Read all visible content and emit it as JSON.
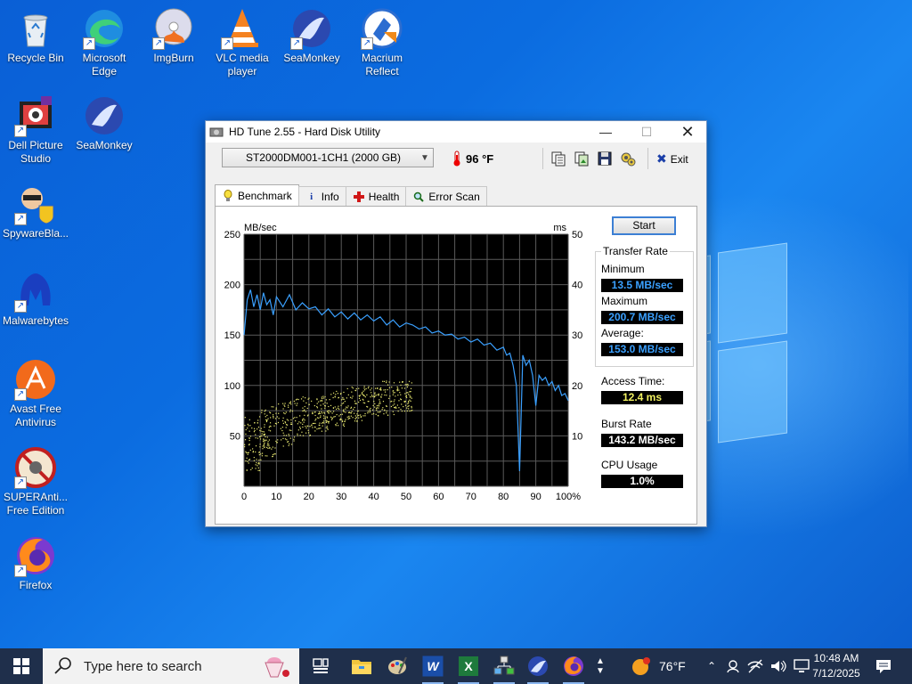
{
  "desktop": {
    "icons": [
      {
        "label": "Recycle Bin",
        "icon": "recycle-bin-icon"
      },
      {
        "label": "Microsoft Edge",
        "icon": "edge-icon"
      },
      {
        "label": "ImgBurn",
        "icon": "imgburn-icon"
      },
      {
        "label": "VLC media player",
        "icon": "vlc-icon"
      },
      {
        "label": "SeaMonkey",
        "icon": "seamonkey-icon"
      },
      {
        "label": "Macrium Reflect",
        "icon": "macrium-icon"
      },
      {
        "label": "Dell Picture Studio",
        "icon": "dell-picture-studio-icon"
      },
      {
        "label": "SeaMonkey",
        "icon": "seamonkey-icon"
      },
      {
        "label": "SpywareBla...",
        "icon": "spywareblaster-icon"
      },
      {
        "label": "Malwarebytes",
        "icon": "malwarebytes-icon"
      },
      {
        "label": "Avast Free Antivirus",
        "icon": "avast-icon"
      },
      {
        "label": "SUPERAnti... Free Edition",
        "icon": "superantispyware-icon"
      },
      {
        "label": "Firefox",
        "icon": "firefox-icon"
      }
    ]
  },
  "window": {
    "title": "HD Tune 2.55 - Hard Disk Utility",
    "drive": "ST2000DM001-1CH1 (2000 GB)",
    "temperature": "96 °F",
    "exit_label": "Exit",
    "tabs": [
      {
        "label": "Benchmark",
        "icon": "lightbulb-icon",
        "active": true
      },
      {
        "label": "Info",
        "icon": "info-icon",
        "active": false
      },
      {
        "label": "Health",
        "icon": "health-cross-icon",
        "active": false
      },
      {
        "label": "Error Scan",
        "icon": "magnifier-icon",
        "active": false
      }
    ],
    "start_label": "Start",
    "transfer_rate_title": "Transfer Rate",
    "minimum_label": "Minimum",
    "minimum_value": "13.5 MB/sec",
    "maximum_label": "Maximum",
    "maximum_value": "200.7 MB/sec",
    "average_label": "Average:",
    "average_value": "153.0 MB/sec",
    "access_time_label": "Access Time:",
    "access_time_value": "12.4 ms",
    "burst_rate_label": "Burst Rate",
    "burst_rate_value": "143.2 MB/sec",
    "cpu_usage_label": "CPU Usage",
    "cpu_usage_value": "1.0%",
    "colors": {
      "transfer": "#3aa0ff",
      "access": "#e8e870",
      "cpu": "#ffffff",
      "burst": "#ffffff"
    }
  },
  "chart_data": {
    "type": "line",
    "left_unit": "MB/sec",
    "right_unit": "ms",
    "y_left_ticks": [
      "250",
      "200",
      "150",
      "100",
      "50"
    ],
    "y_right_ticks": [
      "50",
      "40",
      "30",
      "20",
      "10"
    ],
    "x_ticks": [
      "0",
      "10",
      "20",
      "30",
      "40",
      "50",
      "60",
      "70",
      "80",
      "90",
      "100%"
    ],
    "ylim_left": [
      0,
      250
    ],
    "ylim_right": [
      0,
      50
    ],
    "xlim": [
      0,
      100
    ],
    "grid": true,
    "series": [
      {
        "name": "Transfer Rate",
        "axis": "left",
        "x": [
          0,
          1,
          2,
          3,
          4,
          5,
          6,
          7,
          8,
          9,
          10,
          12,
          14,
          16,
          18,
          20,
          22,
          24,
          26,
          28,
          30,
          32,
          34,
          36,
          38,
          40,
          42,
          44,
          46,
          48,
          50,
          52,
          54,
          56,
          58,
          60,
          62,
          64,
          66,
          68,
          70,
          72,
          74,
          76,
          78,
          80,
          81,
          82,
          83,
          84,
          85,
          86,
          87,
          88,
          89,
          90,
          91,
          92,
          93,
          94,
          95,
          96,
          97,
          98,
          99,
          100
        ],
        "y": [
          150,
          185,
          195,
          178,
          190,
          175,
          192,
          180,
          185,
          170,
          188,
          178,
          190,
          175,
          182,
          176,
          178,
          170,
          176,
          168,
          173,
          166,
          172,
          165,
          170,
          164,
          168,
          160,
          165,
          158,
          162,
          160,
          156,
          158,
          152,
          154,
          150,
          151,
          146,
          148,
          143,
          146,
          140,
          142,
          135,
          138,
          130,
          132,
          120,
          100,
          15,
          130,
          120,
          125,
          110,
          80,
          110,
          105,
          108,
          100,
          104,
          95,
          100,
          90,
          92,
          85
        ]
      },
      {
        "name": "Access Time",
        "axis": "right",
        "type": "scatter",
        "x_range": [
          0,
          52
        ],
        "y_band_low": [
          3,
          6,
          8,
          10,
          11,
          12,
          13,
          14,
          14,
          15,
          15
        ],
        "y_band_high": [
          14,
          16,
          17,
          18,
          18,
          19,
          20,
          20,
          21,
          21,
          22
        ]
      }
    ]
  },
  "taskbar": {
    "search_placeholder": "Type here to search",
    "weather": "76°F",
    "time": "10:48 AM",
    "date": "7/12/2025",
    "apps": [
      "task-view-icon",
      "file-explorer-icon",
      "paint-icon",
      "word-icon",
      "excel-icon",
      "network-app-icon",
      "seamonkey-icon",
      "firefox-icon"
    ]
  }
}
